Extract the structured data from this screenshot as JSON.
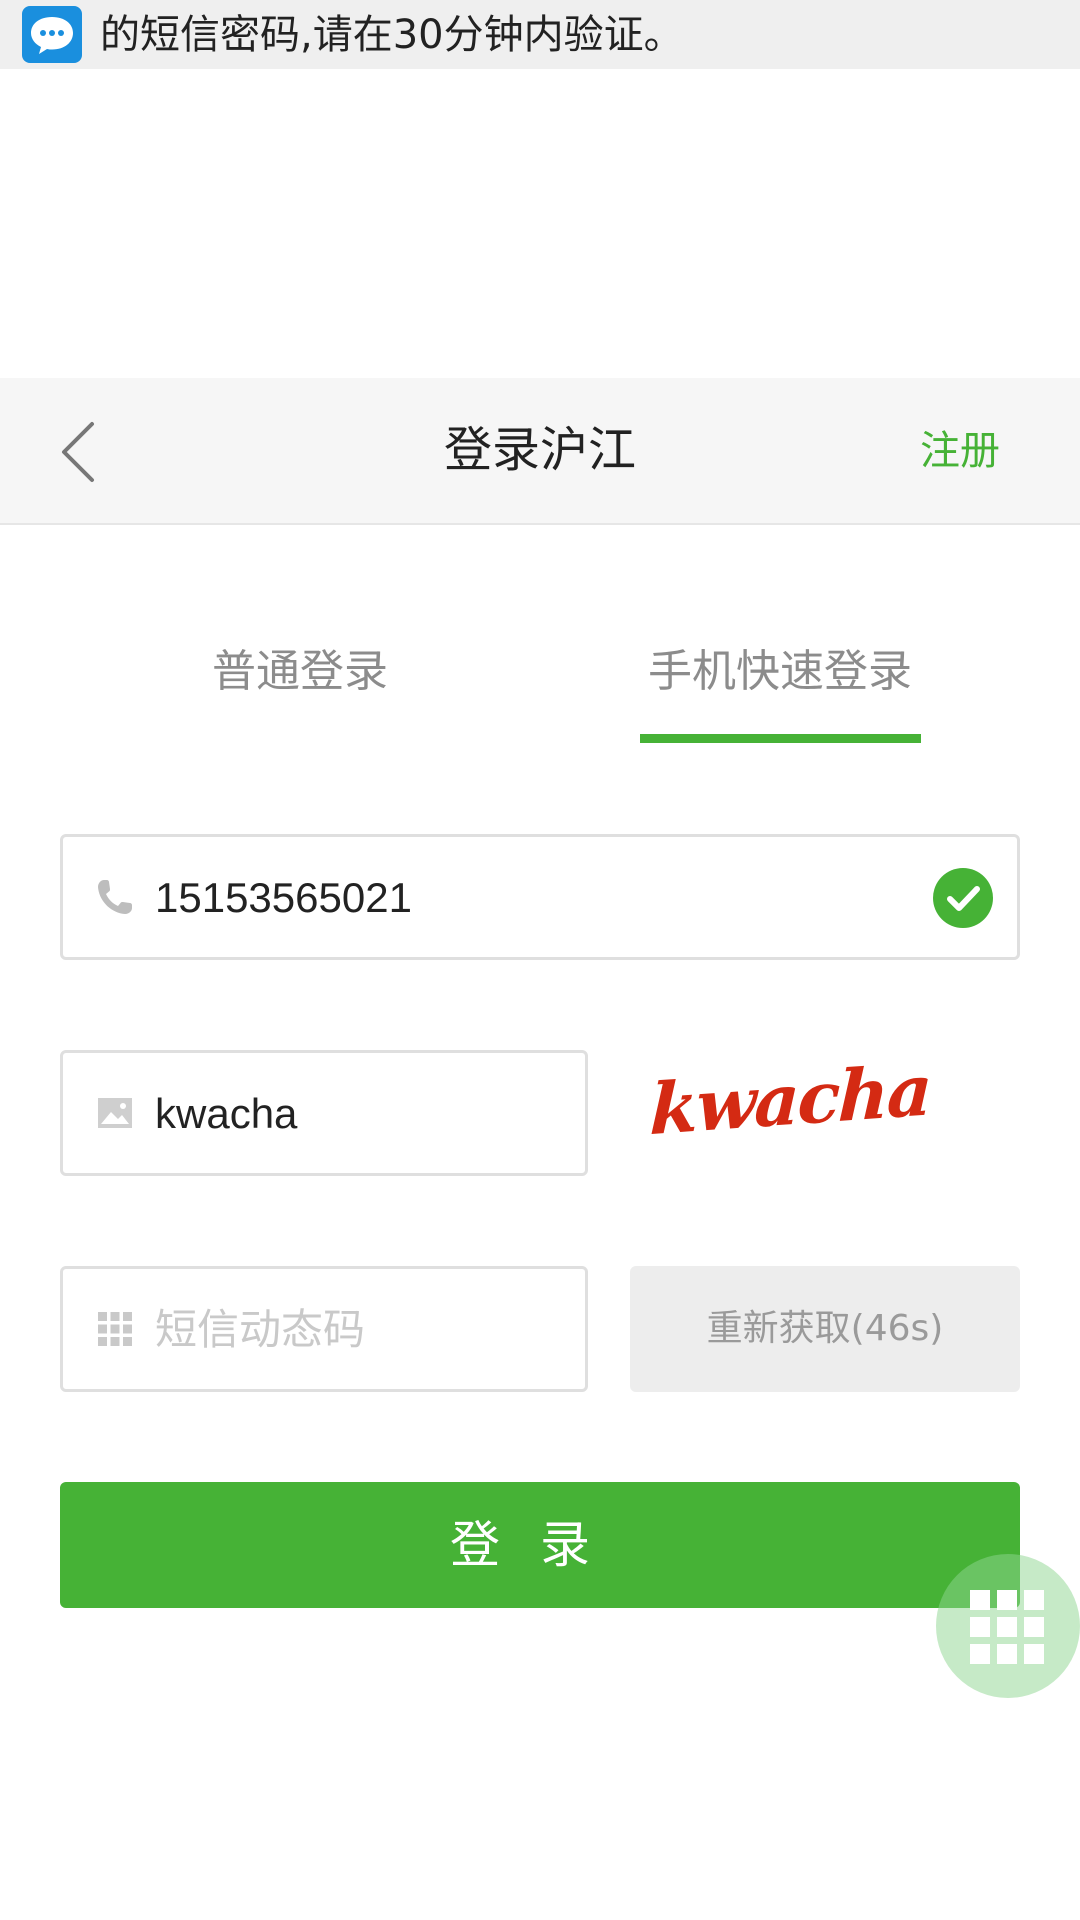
{
  "notification": {
    "text": "的短信密码,请在30分钟内验证。",
    "icon": "chat-bubble-icon",
    "icon_color": "#1a8fde"
  },
  "header": {
    "title": "登录沪江",
    "register_label": "注册",
    "back_icon": "chevron-left-icon"
  },
  "tabs": [
    {
      "label": "普通登录",
      "active": false
    },
    {
      "label": "手机快速登录",
      "active": true
    }
  ],
  "phone_field": {
    "value": "15153565021",
    "icon": "phone-icon",
    "status_icon": "check-circle-icon"
  },
  "captcha_field": {
    "value": "kwacha",
    "icon": "image-icon",
    "captcha_image_text": "kwacha"
  },
  "sms_field": {
    "placeholder": "短信动态码",
    "icon": "grid-icon"
  },
  "resend_button": {
    "label": "重新获取(46s)"
  },
  "login_button": {
    "label": "登录"
  },
  "floating_menu": {
    "icon": "grid-menu-icon"
  },
  "colors": {
    "accent": "#46b236",
    "captcha": "#d42a13"
  }
}
